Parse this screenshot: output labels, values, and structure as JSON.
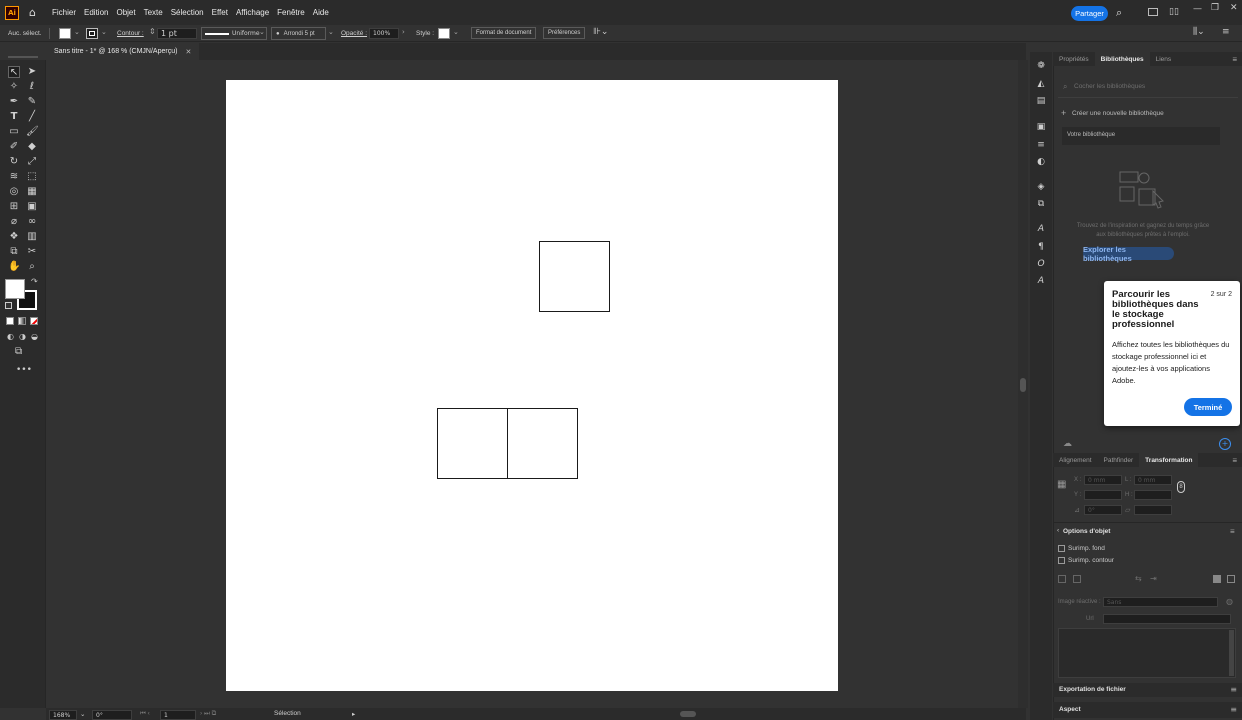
{
  "app": {
    "logo": "Ai"
  },
  "menu": [
    "Fichier",
    "Edition",
    "Objet",
    "Texte",
    "Sélection",
    "Effet",
    "Affichage",
    "Fenêtre",
    "Aide"
  ],
  "share_label": "Partager",
  "control": {
    "selection_label": "Auc. sélect.",
    "stroke_label": "Contour :",
    "stroke_weight": "1 pt",
    "stroke_profile": "Uniforme",
    "brush": "Arrondi 5 pt",
    "opacity_label": "Opacité :",
    "opacity_value": "100%",
    "style_label": "Style :",
    "doc_format_btn": "Format de document",
    "prefs_btn": "Préférences"
  },
  "doc_tab": "Sans titre - 1* @ 168 % (CMJN/Aperçu)",
  "panel_tabs_top": [
    "Propriétés",
    "Bibliothèques",
    "Liens"
  ],
  "libraries": {
    "search_placeholder": "Cocher les bibliothèques",
    "create_label": "Créer une nouvelle bibliothèque",
    "your_library": "Votre bibliothèque",
    "promo": "Trouvez de l'inspiration et gagnez du temps grâce aux bibliothèques prêtes à l'emploi.",
    "explore_btn": "Explorer les bibliothèques"
  },
  "coachmark": {
    "title": "Parcourir les bibliothèques dans le stockage professionnel",
    "step": "2 sur 2",
    "body": "Affichez toutes les bibliothèques du stockage professionnel ici et ajoutez-les à vos applications Adobe.",
    "done_btn": "Terminé"
  },
  "panel_tabs_bottom": [
    "Alignement",
    "Pathfinder",
    "Transformation"
  ],
  "transform": {
    "x": "X :",
    "y": "Y :",
    "w": "L :",
    "h": "H :",
    "x_val": "0 mm",
    "y_val": "0 mm",
    "angle": "0°"
  },
  "options": {
    "title": "Options d'objet",
    "overprint_fill": "Surimp. fond",
    "overprint_stroke": "Surimp. contour",
    "responsive_label": "Image réactive :",
    "responsive_value": "Sans",
    "url_label": "Url"
  },
  "export_panel": "Exportation de fichier",
  "aspect_panel": "Aspect",
  "status": {
    "zoom": "168%",
    "rotation": "0°",
    "artboard": "1",
    "tool": "Sélection"
  },
  "colors": {
    "accent": "#1473e6",
    "artboard": "#ffffff",
    "ui_bg": "#323232"
  }
}
